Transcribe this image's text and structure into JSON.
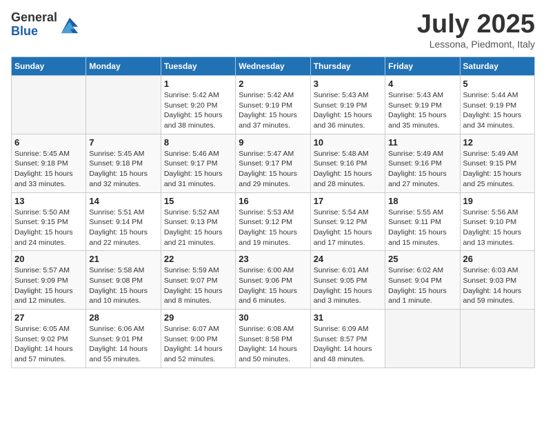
{
  "header": {
    "logo_general": "General",
    "logo_blue": "Blue",
    "title": "July 2025",
    "subtitle": "Lessona, Piedmont, Italy"
  },
  "days_of_week": [
    "Sunday",
    "Monday",
    "Tuesday",
    "Wednesday",
    "Thursday",
    "Friday",
    "Saturday"
  ],
  "weeks": [
    [
      {
        "day": "",
        "info": ""
      },
      {
        "day": "",
        "info": ""
      },
      {
        "day": "1",
        "info": "Sunrise: 5:42 AM\nSunset: 9:20 PM\nDaylight: 15 hours\nand 38 minutes."
      },
      {
        "day": "2",
        "info": "Sunrise: 5:42 AM\nSunset: 9:19 PM\nDaylight: 15 hours\nand 37 minutes."
      },
      {
        "day": "3",
        "info": "Sunrise: 5:43 AM\nSunset: 9:19 PM\nDaylight: 15 hours\nand 36 minutes."
      },
      {
        "day": "4",
        "info": "Sunrise: 5:43 AM\nSunset: 9:19 PM\nDaylight: 15 hours\nand 35 minutes."
      },
      {
        "day": "5",
        "info": "Sunrise: 5:44 AM\nSunset: 9:19 PM\nDaylight: 15 hours\nand 34 minutes."
      }
    ],
    [
      {
        "day": "6",
        "info": "Sunrise: 5:45 AM\nSunset: 9:18 PM\nDaylight: 15 hours\nand 33 minutes."
      },
      {
        "day": "7",
        "info": "Sunrise: 5:45 AM\nSunset: 9:18 PM\nDaylight: 15 hours\nand 32 minutes."
      },
      {
        "day": "8",
        "info": "Sunrise: 5:46 AM\nSunset: 9:17 PM\nDaylight: 15 hours\nand 31 minutes."
      },
      {
        "day": "9",
        "info": "Sunrise: 5:47 AM\nSunset: 9:17 PM\nDaylight: 15 hours\nand 29 minutes."
      },
      {
        "day": "10",
        "info": "Sunrise: 5:48 AM\nSunset: 9:16 PM\nDaylight: 15 hours\nand 28 minutes."
      },
      {
        "day": "11",
        "info": "Sunrise: 5:49 AM\nSunset: 9:16 PM\nDaylight: 15 hours\nand 27 minutes."
      },
      {
        "day": "12",
        "info": "Sunrise: 5:49 AM\nSunset: 9:15 PM\nDaylight: 15 hours\nand 25 minutes."
      }
    ],
    [
      {
        "day": "13",
        "info": "Sunrise: 5:50 AM\nSunset: 9:15 PM\nDaylight: 15 hours\nand 24 minutes."
      },
      {
        "day": "14",
        "info": "Sunrise: 5:51 AM\nSunset: 9:14 PM\nDaylight: 15 hours\nand 22 minutes."
      },
      {
        "day": "15",
        "info": "Sunrise: 5:52 AM\nSunset: 9:13 PM\nDaylight: 15 hours\nand 21 minutes."
      },
      {
        "day": "16",
        "info": "Sunrise: 5:53 AM\nSunset: 9:12 PM\nDaylight: 15 hours\nand 19 minutes."
      },
      {
        "day": "17",
        "info": "Sunrise: 5:54 AM\nSunset: 9:12 PM\nDaylight: 15 hours\nand 17 minutes."
      },
      {
        "day": "18",
        "info": "Sunrise: 5:55 AM\nSunset: 9:11 PM\nDaylight: 15 hours\nand 15 minutes."
      },
      {
        "day": "19",
        "info": "Sunrise: 5:56 AM\nSunset: 9:10 PM\nDaylight: 15 hours\nand 13 minutes."
      }
    ],
    [
      {
        "day": "20",
        "info": "Sunrise: 5:57 AM\nSunset: 9:09 PM\nDaylight: 15 hours\nand 12 minutes."
      },
      {
        "day": "21",
        "info": "Sunrise: 5:58 AM\nSunset: 9:08 PM\nDaylight: 15 hours\nand 10 minutes."
      },
      {
        "day": "22",
        "info": "Sunrise: 5:59 AM\nSunset: 9:07 PM\nDaylight: 15 hours\nand 8 minutes."
      },
      {
        "day": "23",
        "info": "Sunrise: 6:00 AM\nSunset: 9:06 PM\nDaylight: 15 hours\nand 6 minutes."
      },
      {
        "day": "24",
        "info": "Sunrise: 6:01 AM\nSunset: 9:05 PM\nDaylight: 15 hours\nand 3 minutes."
      },
      {
        "day": "25",
        "info": "Sunrise: 6:02 AM\nSunset: 9:04 PM\nDaylight: 15 hours\nand 1 minute."
      },
      {
        "day": "26",
        "info": "Sunrise: 6:03 AM\nSunset: 9:03 PM\nDaylight: 14 hours\nand 59 minutes."
      }
    ],
    [
      {
        "day": "27",
        "info": "Sunrise: 6:05 AM\nSunset: 9:02 PM\nDaylight: 14 hours\nand 57 minutes."
      },
      {
        "day": "28",
        "info": "Sunrise: 6:06 AM\nSunset: 9:01 PM\nDaylight: 14 hours\nand 55 minutes."
      },
      {
        "day": "29",
        "info": "Sunrise: 6:07 AM\nSunset: 9:00 PM\nDaylight: 14 hours\nand 52 minutes."
      },
      {
        "day": "30",
        "info": "Sunrise: 6:08 AM\nSunset: 8:58 PM\nDaylight: 14 hours\nand 50 minutes."
      },
      {
        "day": "31",
        "info": "Sunrise: 6:09 AM\nSunset: 8:57 PM\nDaylight: 14 hours\nand 48 minutes."
      },
      {
        "day": "",
        "info": ""
      },
      {
        "day": "",
        "info": ""
      }
    ]
  ]
}
